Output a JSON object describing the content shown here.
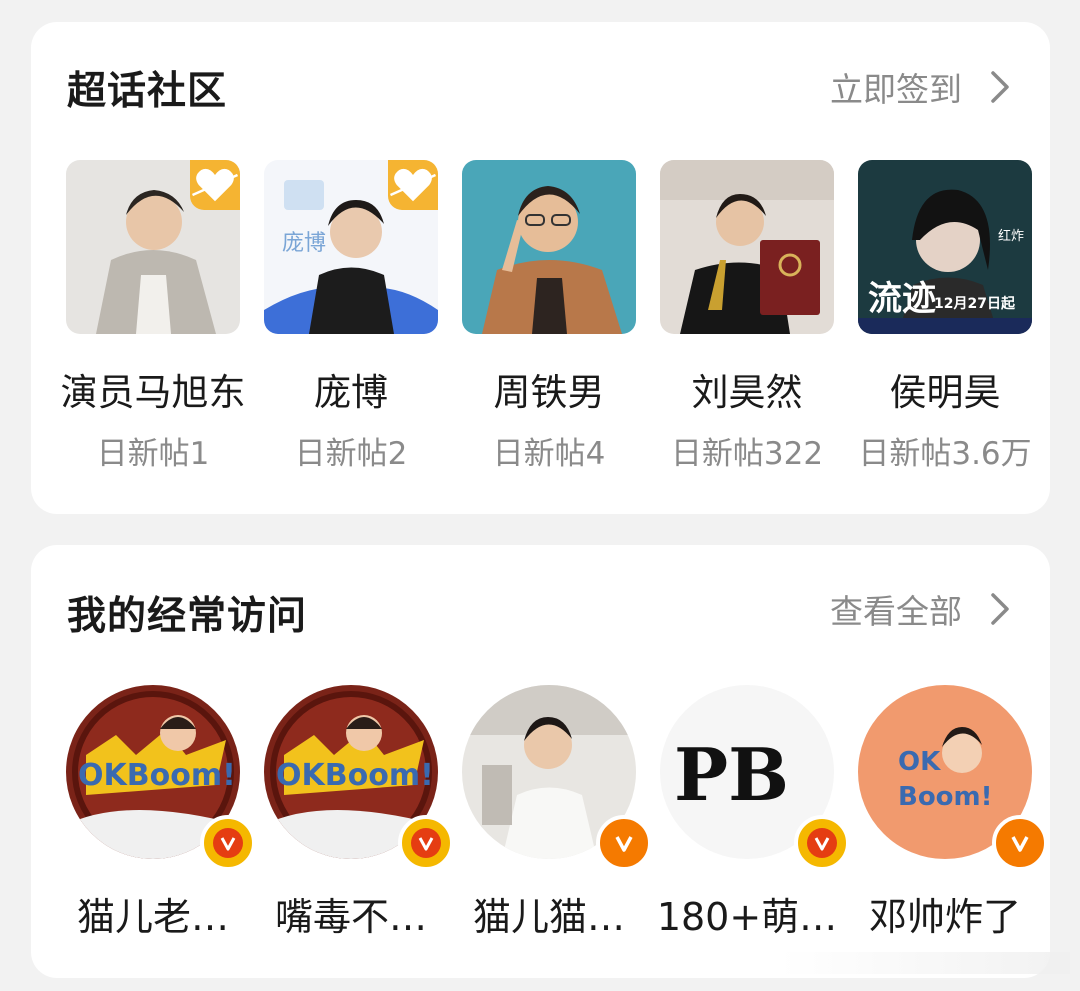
{
  "super_topic": {
    "title": "超话社区",
    "action_label": "立即签到",
    "items": [
      {
        "name": "演员马旭东",
        "stat": "日新帖1",
        "favorited": true
      },
      {
        "name": "庞博",
        "stat": "日新帖2",
        "favorited": true
      },
      {
        "name": "周铁男",
        "stat": "日新帖4",
        "favorited": false
      },
      {
        "name": "刘昊然",
        "stat": "日新帖322",
        "favorited": false
      },
      {
        "name": "侯明昊",
        "stat": "日新帖3.6万",
        "favorited": false
      }
    ],
    "thumb_texts": {
      "pangbo": "庞博",
      "houminghao_1": "流迹",
      "houminghao_2": "12月27日起",
      "houminghao_3": "红炸"
    }
  },
  "frequent": {
    "title": "我的经常访问",
    "action_label": "查看全部",
    "items": [
      {
        "name": "猫儿老…",
        "logo_text": "OKBoom!"
      },
      {
        "name": "嘴毒不…",
        "logo_text": "OKBoom!"
      },
      {
        "name": "猫儿猫…"
      },
      {
        "name": "180+萌…",
        "logo_text": "PB"
      },
      {
        "name": "邓帅炸了",
        "logo_text_1": "OK",
        "logo_text_2": "Boom!"
      }
    ]
  },
  "colors": {
    "background": "#f2f2f2",
    "card": "#ffffff",
    "badge_orange": "#f57a00",
    "badge_yellow": "#f5b800",
    "fav_badge": "#f5b432"
  }
}
